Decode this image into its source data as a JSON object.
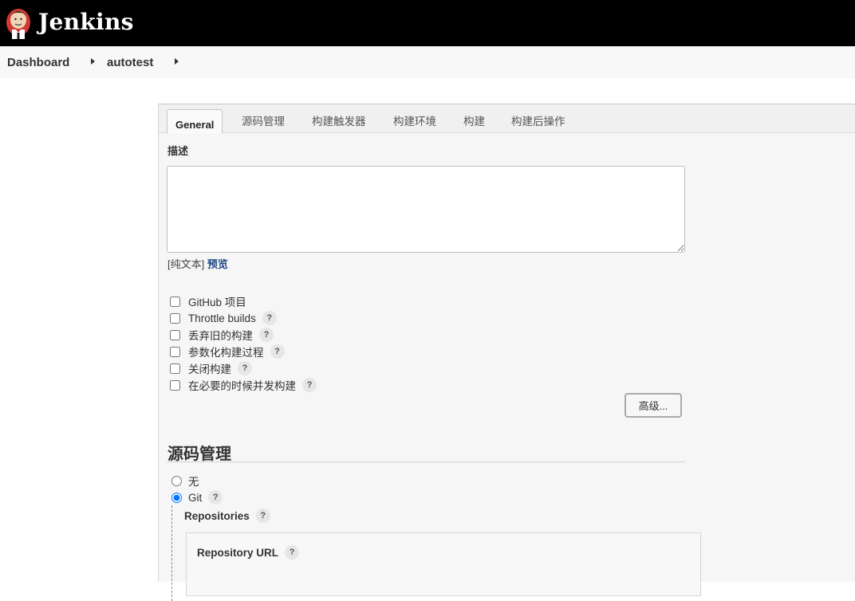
{
  "header": {
    "brand": "Jenkins",
    "logo_icon": "jenkins-butler-icon"
  },
  "breadcrumb": {
    "items": [
      "Dashboard",
      "autotest"
    ]
  },
  "tabs": [
    "General",
    "源码管理",
    "构建触发器",
    "构建环境",
    "构建",
    "构建后操作"
  ],
  "general": {
    "description_label": "描述",
    "description_value": "",
    "format_text": "[纯文本]",
    "preview_link": "预览",
    "options": [
      {
        "label": "GitHub 项目",
        "checked": false,
        "help": false
      },
      {
        "label": "Throttle builds",
        "checked": false,
        "help": true
      },
      {
        "label": "丢弃旧的构建",
        "checked": false,
        "help": true
      },
      {
        "label": "参数化构建过程",
        "checked": false,
        "help": true
      },
      {
        "label": "关闭构建",
        "checked": false,
        "help": true
      },
      {
        "label": "在必要的时候并发构建",
        "checked": false,
        "help": true
      }
    ],
    "advanced_button": "高级..."
  },
  "scm": {
    "heading": "源码管理",
    "options": [
      {
        "label": "无",
        "selected": false,
        "help": false
      },
      {
        "label": "Git",
        "selected": true,
        "help": true
      }
    ],
    "repositories_label": "Repositories",
    "repository_url_label": "Repository URL"
  },
  "help_glyph": "?"
}
